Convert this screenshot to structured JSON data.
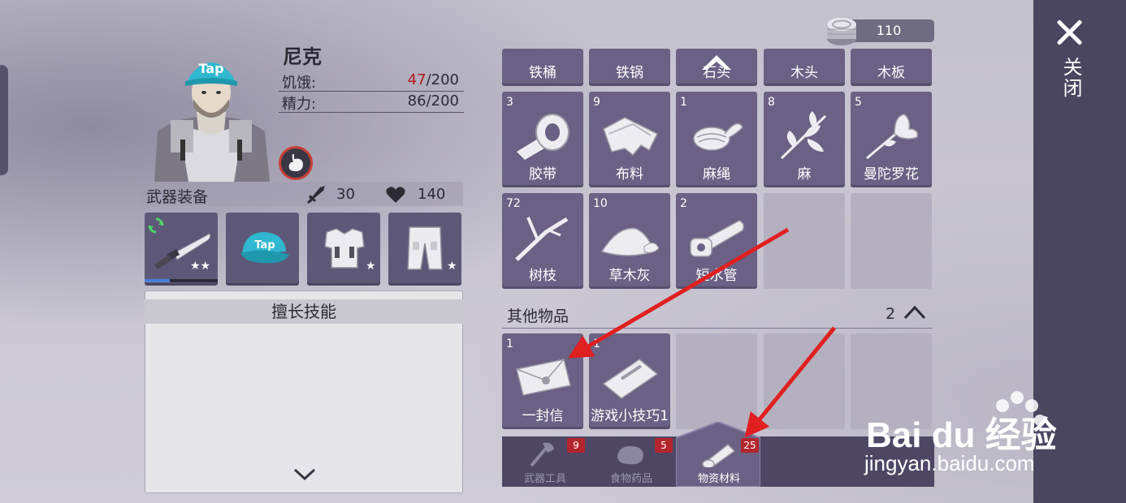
{
  "character": {
    "name": "尼克",
    "hunger_label": "饥饿:",
    "hunger_current": "47",
    "hunger_max": "/200",
    "energy_label": "精力:",
    "energy_value": "86/200",
    "hat_text": "Tap"
  },
  "currency": {
    "value": "110"
  },
  "close": {
    "label": "关闭"
  },
  "equipment": {
    "title": "武器装备",
    "attack": "30",
    "health": "140",
    "slots": [
      {
        "item": "knife",
        "stars": "★★"
      },
      {
        "item": "cap",
        "hat_text": "Tap",
        "stars": ""
      },
      {
        "item": "armor",
        "stars": "★"
      },
      {
        "item": "pants",
        "stars": "★"
      }
    ],
    "durability": 0.35
  },
  "skills": {
    "title": "擅长技能"
  },
  "inventory": {
    "top_row": [
      "铁桶",
      "铁锅",
      "石头",
      "木头",
      "木板"
    ],
    "row2": [
      {
        "count": "3",
        "name": "胶带"
      },
      {
        "count": "9",
        "name": "布料"
      },
      {
        "count": "1",
        "name": "麻绳"
      },
      {
        "count": "8",
        "name": "麻"
      },
      {
        "count": "5",
        "name": "曼陀罗花"
      }
    ],
    "row3": [
      {
        "count": "72",
        "name": "树枝"
      },
      {
        "count": "10",
        "name": "草木灰"
      },
      {
        "count": "2",
        "name": "短水管"
      }
    ],
    "other_section": {
      "title": "其他物品",
      "count": "2"
    },
    "other_items": [
      {
        "count": "1",
        "name": "一封信"
      },
      {
        "count": "1",
        "name": "游戏小技巧1"
      }
    ]
  },
  "tabs": [
    {
      "label": "武器工具",
      "badge": "9",
      "icon": "axe-icon"
    },
    {
      "label": "食物药品",
      "badge": "5",
      "icon": "meat-icon"
    },
    {
      "label": "物资材料",
      "badge": "25",
      "icon": "log-icon",
      "active": true
    }
  ],
  "watermark": {
    "brand": "Bai du 经验",
    "url": "jingyan.baidu.com"
  },
  "colors": {
    "panel": "#6a6184",
    "tabbar": "#4d4764",
    "badge": "#b3252c",
    "arrow": "#e02020"
  }
}
